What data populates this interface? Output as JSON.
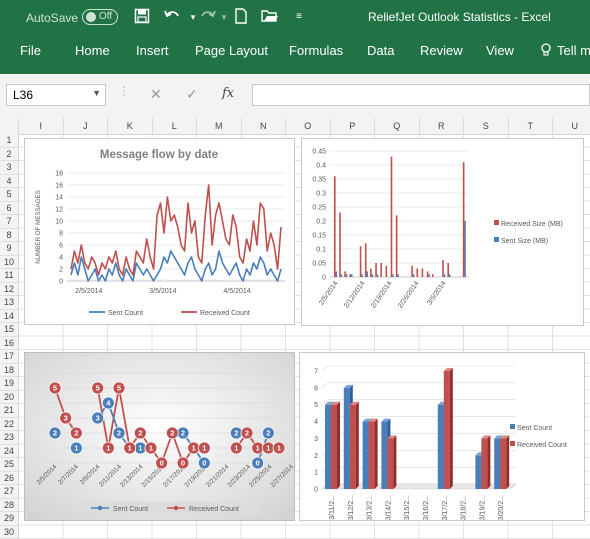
{
  "titlebar": {
    "autosave_label": "AutoSave",
    "autosave_state": "Off",
    "document_title": "ReliefJet Outlook Statistics  -  Excel"
  },
  "quick_access": [
    "save-icon",
    "undo-icon",
    "redo-icon",
    "new-file-icon",
    "open-folder-icon",
    "customize-icon"
  ],
  "ribbon_tabs": [
    "File",
    "Home",
    "Insert",
    "Page Layout",
    "Formulas",
    "Data",
    "Review",
    "View",
    "Tell m"
  ],
  "formula_bar": {
    "name_box": "L36",
    "fx_label": "fx",
    "value": ""
  },
  "column_headers": [
    "I",
    "J",
    "K",
    "L",
    "M",
    "N",
    "O",
    "P",
    "Q",
    "R",
    "S",
    "T",
    "U"
  ],
  "row_headers": [
    "1",
    "2",
    "3",
    "4",
    "5",
    "6",
    "7",
    "8",
    "9",
    "10",
    "11",
    "12",
    "13",
    "14",
    "15",
    "16",
    "17",
    "18",
    "19",
    "20",
    "21",
    "22",
    "23",
    "24",
    "25",
    "26",
    "27",
    "28",
    "29",
    "30"
  ],
  "colors": {
    "excel_green": "#217346",
    "sent": "#4a7ebb",
    "received": "#c0504d"
  },
  "charts": [
    {
      "id": "message-flow",
      "chart_data": {
        "type": "line",
        "title": "Message flow by date",
        "ylabel": "NUMBER OF MESSAGES",
        "xlabel": "",
        "ylim": [
          0,
          18
        ],
        "yticks": [
          0,
          2,
          4,
          6,
          8,
          10,
          12,
          14,
          16,
          18
        ],
        "xtick_labels": [
          "2/5/2014",
          "3/5/2014",
          "4/5/2014"
        ],
        "legend_position": "bottom",
        "series": [
          {
            "name": "Sent Count",
            "values": [
              1,
              3,
              1,
              4,
              2,
              0,
              1,
              2,
              0,
              1,
              0,
              2,
              1,
              3,
              1,
              0,
              2,
              1,
              0,
              3,
              2,
              1,
              2,
              1,
              0,
              1,
              2,
              4,
              3,
              5,
              4,
              3,
              2,
              1,
              3,
              4,
              2,
              1,
              0,
              2,
              3,
              1,
              2,
              5,
              3,
              2,
              1,
              2,
              3,
              1,
              0,
              2,
              1,
              3,
              2,
              4,
              3,
              1,
              2,
              1,
              0,
              2
            ]
          },
          {
            "name": "Received Count",
            "values": [
              2,
              5,
              3,
              6,
              3,
              2,
              4,
              3,
              1,
              3,
              2,
              4,
              3,
              5,
              2,
              1,
              4,
              2,
              1,
              5,
              4,
              3,
              7,
              4,
              2,
              11,
              13,
              8,
              14,
              10,
              11,
              9,
              6,
              5,
              13,
              8,
              10,
              4,
              3,
              11,
              16,
              6,
              11,
              13,
              10,
              7,
              6,
              11,
              9,
              4,
              3,
              7,
              5,
              10,
              6,
              13,
              12,
              5,
              8,
              6,
              2,
              9
            ]
          }
        ]
      }
    },
    {
      "id": "size-chart",
      "chart_data": {
        "type": "bar",
        "title": "",
        "ylim": [
          0,
          0.45
        ],
        "yticks": [
          "0",
          "0.05",
          "0.1",
          "0.15",
          "0.2",
          "0.25",
          "0.3",
          "0.35",
          "0.4",
          "0.45"
        ],
        "xtick_labels": [
          "2/5/2014",
          "2/12/2014",
          "2/19/2014",
          "2/26/2014",
          "3/5/2014"
        ],
        "legend_position": "right",
        "series": [
          {
            "name": "Received Size (MB)",
            "values": [
              0.36,
              0.23,
              0.02,
              0.01,
              0.0,
              0.11,
              0.12,
              0.03,
              0.05,
              0.05,
              0.04,
              0.43,
              0.22,
              0.0,
              0.0,
              0.04,
              0.03,
              0.03,
              0.02,
              0.01,
              0.0,
              0.06,
              0.05,
              0.0,
              0.0,
              0.41
            ]
          },
          {
            "name": "Sent Size (MB)",
            "values": [
              0.02,
              0.01,
              0.01,
              0.01,
              0.0,
              0.01,
              0.02,
              0.01,
              0.01,
              0.0,
              0.0,
              0.01,
              0.01,
              0.0,
              0.0,
              0.01,
              0.0,
              0.0,
              0.01,
              0.0,
              0.0,
              0.01,
              0.01,
              0.0,
              0.0,
              0.2
            ]
          }
        ]
      }
    },
    {
      "id": "count-line-chart",
      "chart_data": {
        "type": "line",
        "title": "",
        "ylim": [
          0,
          6
        ],
        "xtick_labels": [
          "2/5/2014",
          "2/7/2014",
          "2/9/2014",
          "2/11/2014",
          "2/13/2014",
          "2/15/2014",
          "2/17/2014",
          "2/19/2014",
          "2/21/2014",
          "2/23/2014",
          "2/25/2014",
          "2/27/2014"
        ],
        "legend_position": "bottom",
        "series": [
          {
            "name": "Sent Count",
            "values": [
              2,
              null,
              1,
              null,
              3,
              4,
              2,
              1,
              1,
              1,
              null,
              2,
              2,
              1,
              0,
              null,
              null,
              2,
              null,
              0,
              2,
              null
            ]
          },
          {
            "name": "Received Count",
            "values": [
              5,
              3,
              2,
              null,
              5,
              1,
              5,
              1,
              2,
              1,
              0,
              2,
              0,
              1,
              1,
              null,
              null,
              1,
              2,
              1,
              1,
              1
            ]
          }
        ]
      }
    },
    {
      "id": "daily-bar-chart",
      "chart_data": {
        "type": "bar",
        "title": "",
        "ylim": [
          0,
          7
        ],
        "yticks": [
          "0",
          "1",
          "2",
          "3",
          "4",
          "5",
          "6",
          "7"
        ],
        "categories": [
          "3/11/2...",
          "3/12/2...",
          "3/13/2...",
          "3/14/2...",
          "3/15/2...",
          "3/16/2...",
          "3/17/2...",
          "3/18/2...",
          "3/19/2...",
          "3/20/2..."
        ],
        "legend_position": "right",
        "series": [
          {
            "name": "Sent Count",
            "values": [
              5,
              6,
              4,
              4,
              0,
              0,
              5,
              0,
              2,
              3
            ]
          },
          {
            "name": "Received Count",
            "values": [
              5,
              5,
              4,
              3,
              0,
              0,
              7,
              0,
              3,
              3
            ]
          }
        ]
      }
    }
  ]
}
